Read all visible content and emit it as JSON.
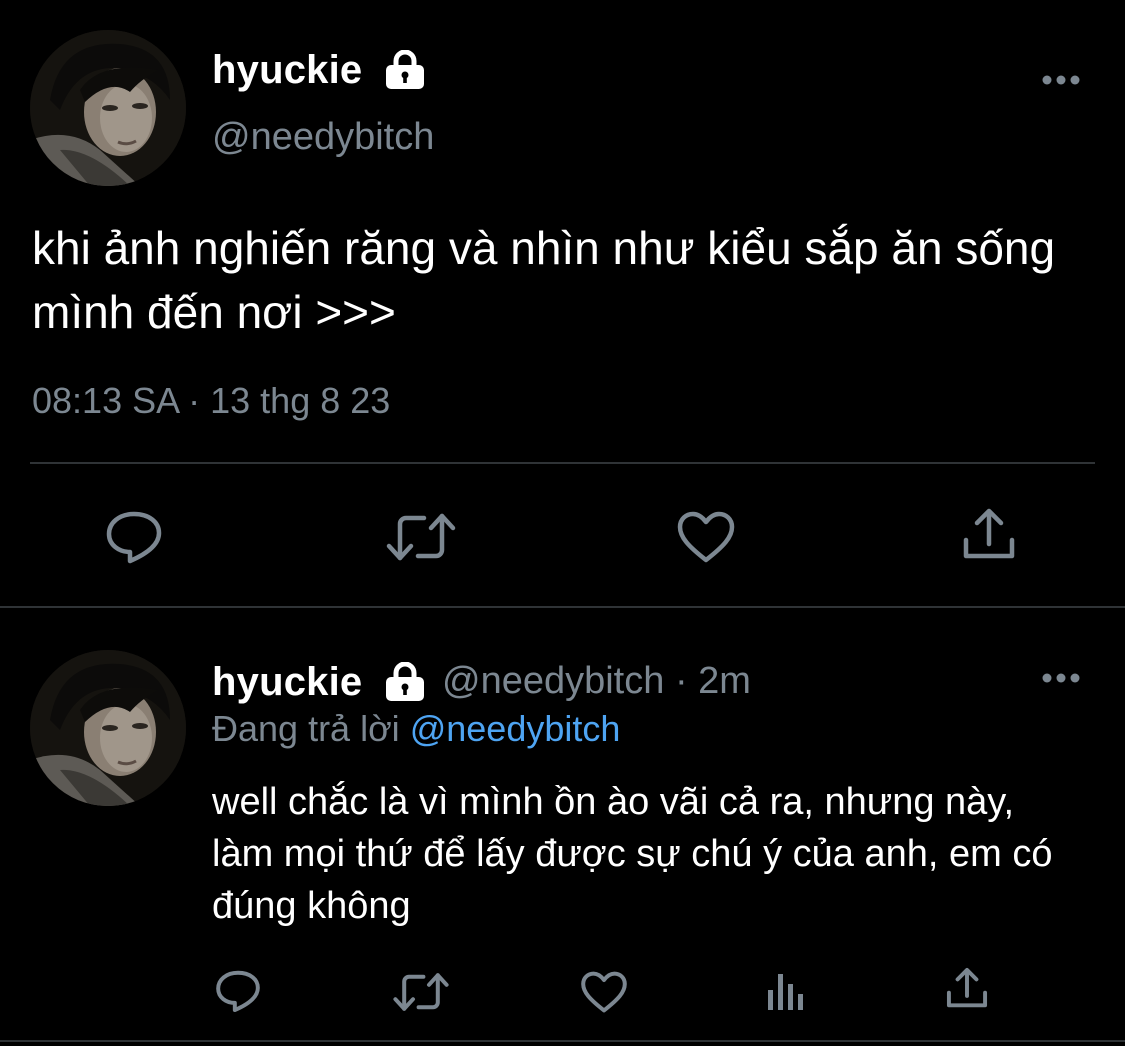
{
  "main_tweet": {
    "display_name": "hyuckie",
    "handle": "@needybitch",
    "text": "khi ảnh nghiến răng và nhìn như kiểu sắp ăn sống mình đến nơi >>>",
    "timestamp": "08:13 SA · 13 thg 8 23",
    "icons": {
      "avatar": "profile-photo",
      "lock": "lock-icon",
      "more": "more-icon",
      "reply": "reply-icon",
      "retweet": "retweet-icon",
      "like": "like-icon",
      "share": "share-icon"
    }
  },
  "reply_tweet": {
    "display_name": "hyuckie",
    "handle": "@needybitch",
    "separator": "·",
    "time": "2m",
    "replying_label": "Đang trả lời",
    "replying_to": "@needybitch",
    "text": "well chắc là vì mình ồn ào vãi cả ra, nhưng này, làm mọi thứ để lấy được sự chú ý của anh, em có đúng không",
    "icons": {
      "avatar": "profile-photo",
      "lock": "lock-icon",
      "more": "more-icon",
      "reply": "reply-icon",
      "retweet": "retweet-icon",
      "like": "like-icon",
      "analytics": "analytics-icon",
      "share": "share-icon"
    }
  },
  "colors": {
    "background": "#000000",
    "primary_text": "#ffffff",
    "secondary_text": "#7c8791",
    "icon": "#7c8791",
    "divider": "#2f3336",
    "mention": "#4ea4f2"
  }
}
